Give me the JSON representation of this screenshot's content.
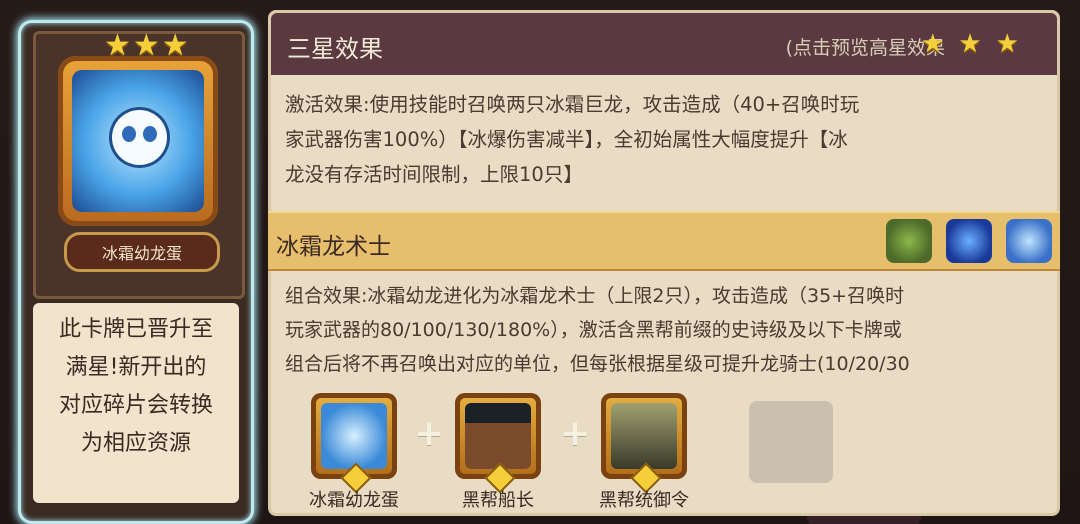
{
  "card": {
    "name": "冰霜幼龙蛋",
    "stars": "★★★",
    "description_lines": [
      "此卡牌已晋升至",
      "满星!新开出的",
      "对应碎片会转换",
      "为相应资源"
    ]
  },
  "panel": {
    "title": "三星效果",
    "preview_hint": "(点击预览高星效果",
    "preview_stars": "★★★",
    "effect_lines": [
      "激活效果:使用技能时召唤两只冰霜巨龙，攻击造成（40+召唤时玩",
      "家武器伤害100%）【冰爆伤害减半】，全初始属性大幅度提升【冰",
      "龙没有存活时间限制，上限10只】"
    ],
    "combo": {
      "name": "冰霜龙术士",
      "icons": [
        "tree-creature-icon",
        "blue-dragon-icon",
        "ice-dragon-icon"
      ],
      "text_lines": [
        "组合效果:冰霜幼龙进化为冰霜龙术士（上限2只），攻击造成（35+召唤时",
        "玩家武器的80/100/130/180%），激活含黑帮前缀的史诗级及以下卡牌或",
        "组合后将不再召唤出对应的单位，但每张根据星级可提升龙骑士(10/20/30"
      ]
    },
    "recipe": {
      "items": [
        {
          "label": "冰霜幼龙蛋",
          "icon": "frost-egg-icon"
        },
        {
          "label": "黑帮船长",
          "icon": "gang-captain-icon"
        },
        {
          "label": "黑帮统御令",
          "icon": "gang-order-icon"
        }
      ],
      "plus": "+"
    }
  },
  "colors": {
    "header_bg": "#5a3a40",
    "combo_bar": "#e6be6c",
    "panel_bg": "#e8dcc4",
    "card_glow": "#bfe9ef",
    "star": "#f5cf3a"
  }
}
